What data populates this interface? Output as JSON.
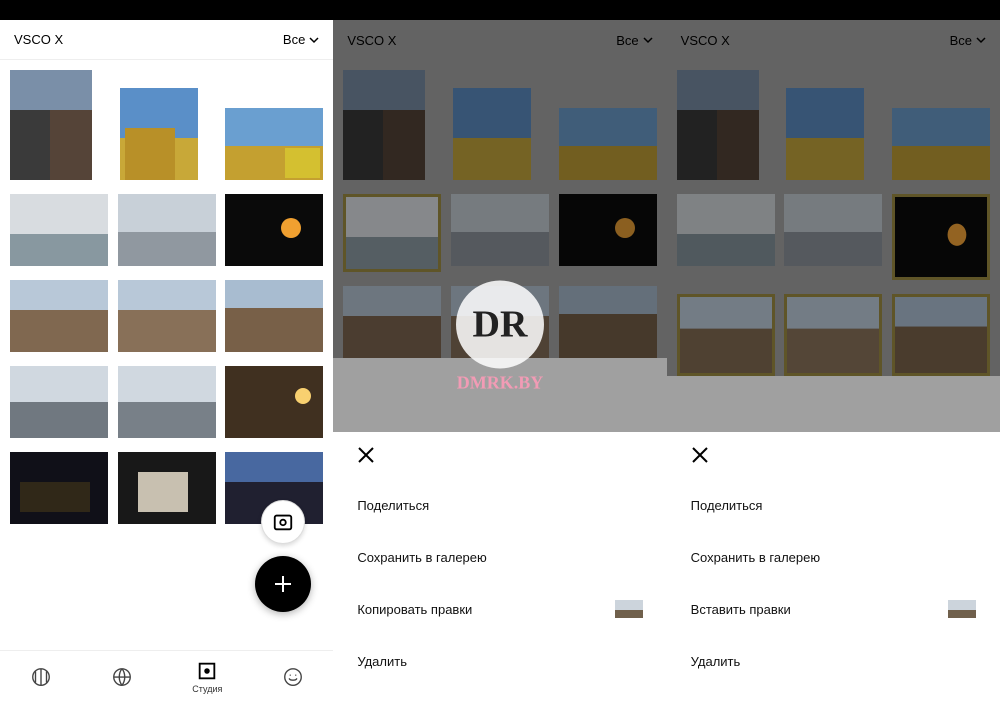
{
  "app_title": "VSCO X",
  "filter_label": "Все",
  "nav": {
    "feed": "",
    "discover": "",
    "studio": "Студия",
    "profile": ""
  },
  "sheet_left": {
    "share": "Поделиться",
    "save": "Сохранить в галерею",
    "copy": "Копировать правки",
    "delete": "Удалить"
  },
  "sheet_right": {
    "share": "Поделиться",
    "save": "Сохранить в галерею",
    "paste": "Вставить правки",
    "delete": "Удалить"
  },
  "watermark": {
    "main": "DR",
    "sub": "DMRK.BY"
  }
}
